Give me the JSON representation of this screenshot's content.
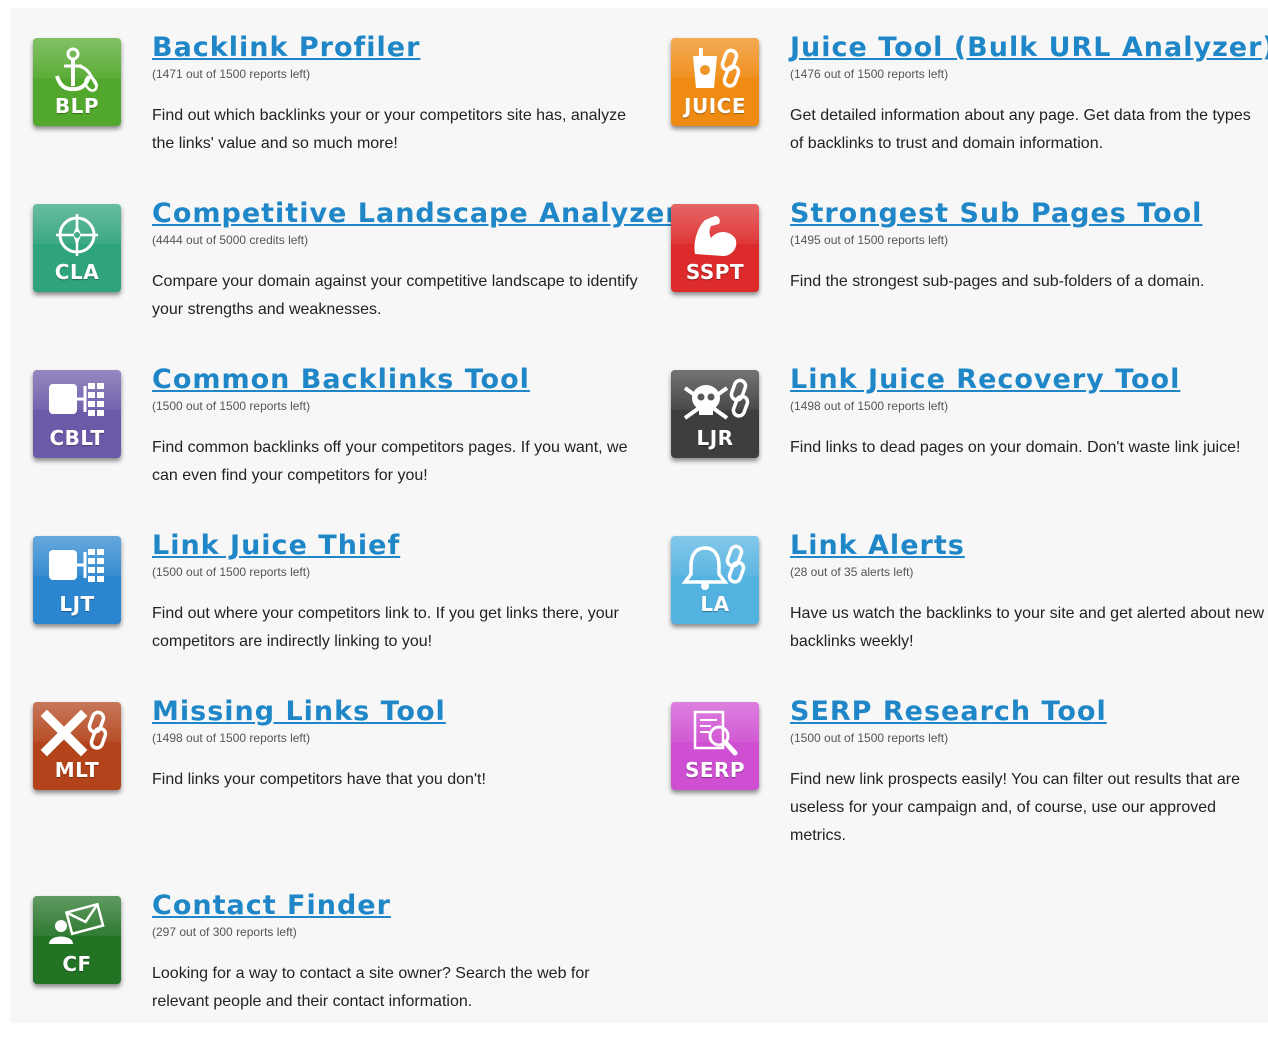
{
  "tools": [
    {
      "abbr": "BLP",
      "title": "Backlink Profiler",
      "quota": "(1471 out of 1500 reports left)",
      "description": "Find out which backlinks your or your competitors site has, analyze the links' value and so much more!",
      "color": "#52a82c",
      "icon": "anchor-icon"
    },
    {
      "abbr": "JUICE",
      "title": "Juice Tool (Bulk URL Analyzer)",
      "quota": "(1476 out of 1500 reports left)",
      "description": "Get detailed information about any page. Get data from the types of backlinks to trust and domain information.",
      "color": "#ef8a12",
      "icon": "juice-cup-icon"
    },
    {
      "abbr": "CLA",
      "title": "Competitive Landscape Analyzer",
      "quota": "(4444 out of 5000 credits left)",
      "description": "Compare your domain against your competitive landscape to identify your strengths and weaknesses.",
      "color": "#2fa37c",
      "icon": "compass-icon"
    },
    {
      "abbr": "SSPT",
      "title": "Strongest Sub Pages Tool",
      "quota": "(1495 out of 1500 reports left)",
      "description": "Find the strongest sub-pages and sub-folders of a domain.",
      "color": "#dd2b2b",
      "icon": "flexed-arm-icon"
    },
    {
      "abbr": "CBLT",
      "title": "Common Backlinks Tool",
      "quota": "(1500 out of 1500 reports left)",
      "description": "Find common backlinks off your competitors pages. If you want, we can even find your competitors for you!",
      "color": "#6c5aa8",
      "icon": "link-tree-icon"
    },
    {
      "abbr": "LJR",
      "title": "Link Juice Recovery Tool",
      "quota": "(1498 out of 1500 reports left)",
      "description": "Find links to dead pages on your domain. Don't waste link juice!",
      "color": "#3e3e3e",
      "icon": "skull-icon"
    },
    {
      "abbr": "LJT",
      "title": "Link Juice Thief",
      "quota": "(1500 out of 1500 reports left)",
      "description": "Find out where your competitors link to. If you get links there, your competitors are indirectly linking to you!",
      "color": "#2b86cf",
      "icon": "link-tree-icon"
    },
    {
      "abbr": "LA",
      "title": "Link Alerts",
      "quota": "(28 out of 35 alerts left)",
      "description": "Have us watch the backlinks to your site and get alerted about new backlinks weekly!",
      "color": "#53b2e0",
      "icon": "bell-icon"
    },
    {
      "abbr": "MLT",
      "title": "Missing Links Tool",
      "quota": "(1498 out of 1500 reports left)",
      "description": "Find links your competitors have that you don't!",
      "color": "#b3431b",
      "icon": "cross-icon"
    },
    {
      "abbr": "SERP",
      "title": "SERP Research Tool",
      "quota": "(1500 out of 1500 reports left)",
      "description": "Find new link prospects easily! You can filter out results that are useless for your campaign and, of course, use our approved metrics.",
      "color": "#cf4fd2",
      "icon": "magnifier-document-icon"
    },
    {
      "abbr": "CF",
      "title": "Contact Finder",
      "quota": "(297 out of 300 reports left)",
      "description": "Looking for a way to contact a site owner? Search the web for relevant people and their contact information.",
      "color": "#237325",
      "icon": "envelope-person-icon"
    }
  ]
}
